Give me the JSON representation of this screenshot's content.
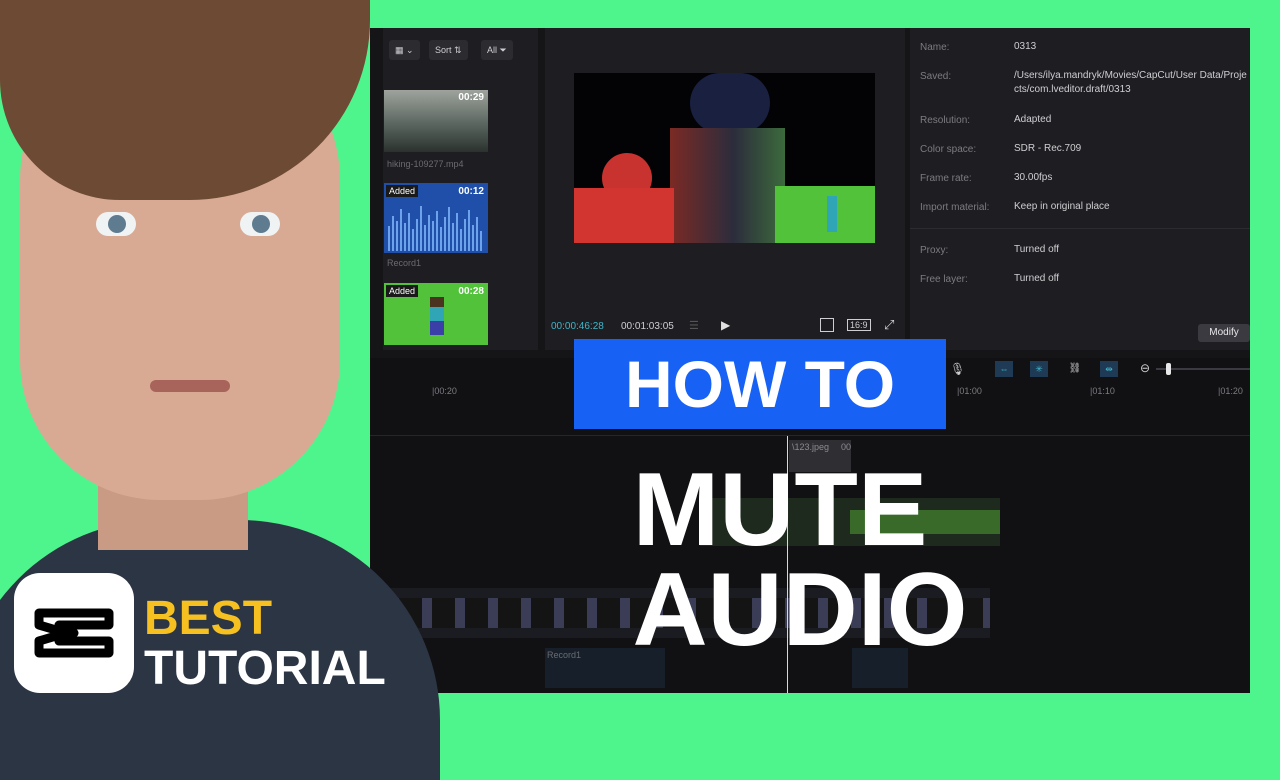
{
  "media_panel": {
    "view_label": "▦ ⌄",
    "sort_label": "Sort",
    "filter_label": "All",
    "items": [
      {
        "duration": "00:29",
        "name": "hiking-109277.mp4"
      },
      {
        "badge": "Added",
        "duration": "00:12",
        "name": "Record1"
      },
      {
        "badge": "Added",
        "duration": "00:28"
      }
    ]
  },
  "preview": {
    "current_time": "00:00:46:28",
    "total_time": "00:01:03:05",
    "aspect_ratio": "16:9"
  },
  "details": {
    "rows": [
      {
        "label": "Name:",
        "value": "0313"
      },
      {
        "label": "Saved:",
        "value": "/Users/ilya.mandryk/Movies/CapCut/User Data/Projects/com.lveditor.draft/0313"
      },
      {
        "label": "Resolution:",
        "value": "Adapted"
      },
      {
        "label": "Color space:",
        "value": "SDR - Rec.709"
      },
      {
        "label": "Frame rate:",
        "value": "30.00fps"
      },
      {
        "label": "Import material:",
        "value": "Keep in original place"
      },
      {
        "label": "Proxy:",
        "value": "Turned off"
      },
      {
        "label": "Free layer:",
        "value": "Turned off"
      }
    ],
    "modify_label": "Modify"
  },
  "timeline": {
    "ruler": [
      "|00:20",
      "|01:00",
      "|01:10",
      "|01:20"
    ],
    "clip_image_name": "\\123.jpeg",
    "clip_image_time": "00",
    "audio_clip_name": "Record1"
  },
  "overlay": {
    "how_to": "HOW TO",
    "line1": "MUTE",
    "line2": "AUDIO",
    "badge_line1": "BEST",
    "badge_line2": "TUTORIAL"
  },
  "colors": {
    "background": "#4ef58c",
    "banner": "#1762f5",
    "accent_yellow": "#f6c120",
    "timecode": "#3fb6c9"
  },
  "icons": [
    "view-grid-icon",
    "sort-icon",
    "filter-icon",
    "play-icon",
    "fullscreen-icon",
    "microphone-icon",
    "zoom-out-icon",
    "capcut-logo-icon"
  ]
}
